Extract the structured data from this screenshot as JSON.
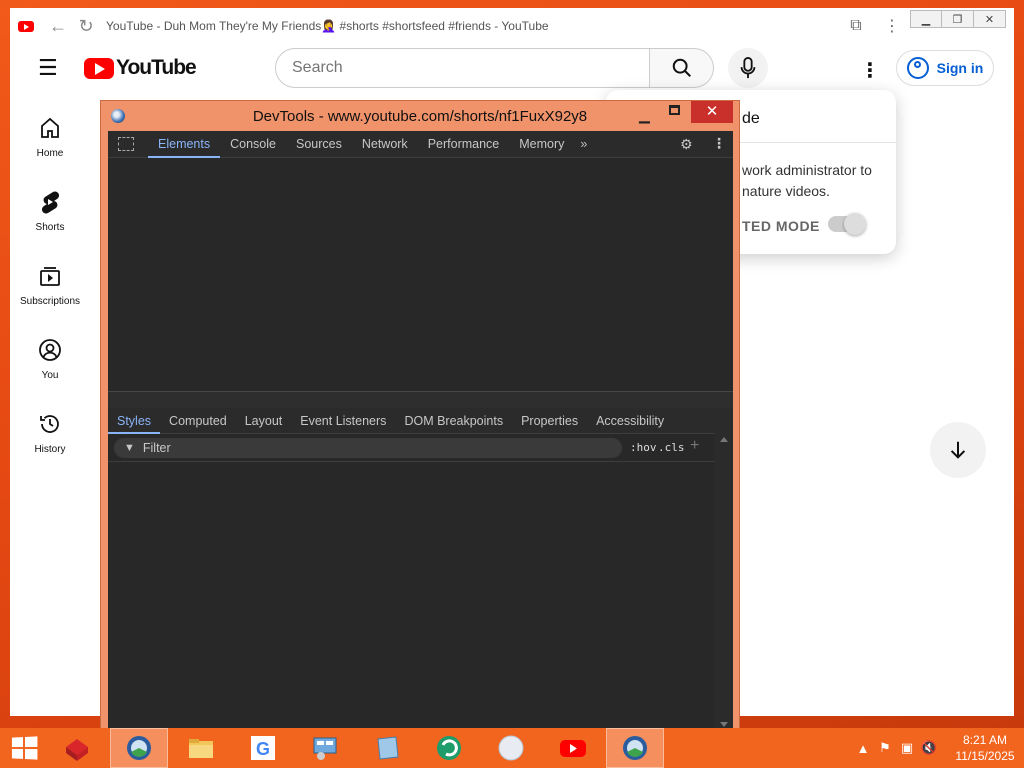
{
  "browser": {
    "tab_title": "YouTube - Duh Mom They're My Friends🤦‍♀️ #shorts #shortsfeed #friends - YouTube"
  },
  "youtube": {
    "logo_text": "YouTube",
    "search_placeholder": "Search",
    "signin_label": "Sign in",
    "sidebar": [
      {
        "label": "Home",
        "icon": "home-icon"
      },
      {
        "label": "Shorts",
        "icon": "shorts-icon"
      },
      {
        "label": "Subscriptions",
        "icon": "subscriptions-icon"
      },
      {
        "label": "You",
        "icon": "you-icon"
      },
      {
        "label": "History",
        "icon": "history-icon"
      }
    ],
    "popup": {
      "title_partial": "de",
      "body_partial": "work administrator to\nnature videos.",
      "mode_partial": "TED MODE"
    }
  },
  "devtools": {
    "title": "DevTools - www.youtube.com/shorts/nf1FuxX92y8",
    "tabs": [
      "Elements",
      "Console",
      "Sources",
      "Network",
      "Performance",
      "Memory"
    ],
    "active_tab": "Elements",
    "style_tabs": [
      "Styles",
      "Computed",
      "Layout",
      "Event Listeners",
      "DOM Breakpoints",
      "Properties",
      "Accessibility"
    ],
    "active_style_tab": "Styles",
    "filter_placeholder": "Filter",
    "hov_label": ":hov",
    "cls_label": ".cls"
  },
  "taskbar": {
    "time": "8:21 AM",
    "date": "11/15/2025"
  },
  "colors": {
    "desktop": "#e8501c",
    "youtube_red": "#ff0000",
    "link_blue": "#065fd4",
    "devtools_frame": "#f0926a",
    "devtools_bg": "#282828",
    "devtools_accent": "#8ab4f8"
  }
}
